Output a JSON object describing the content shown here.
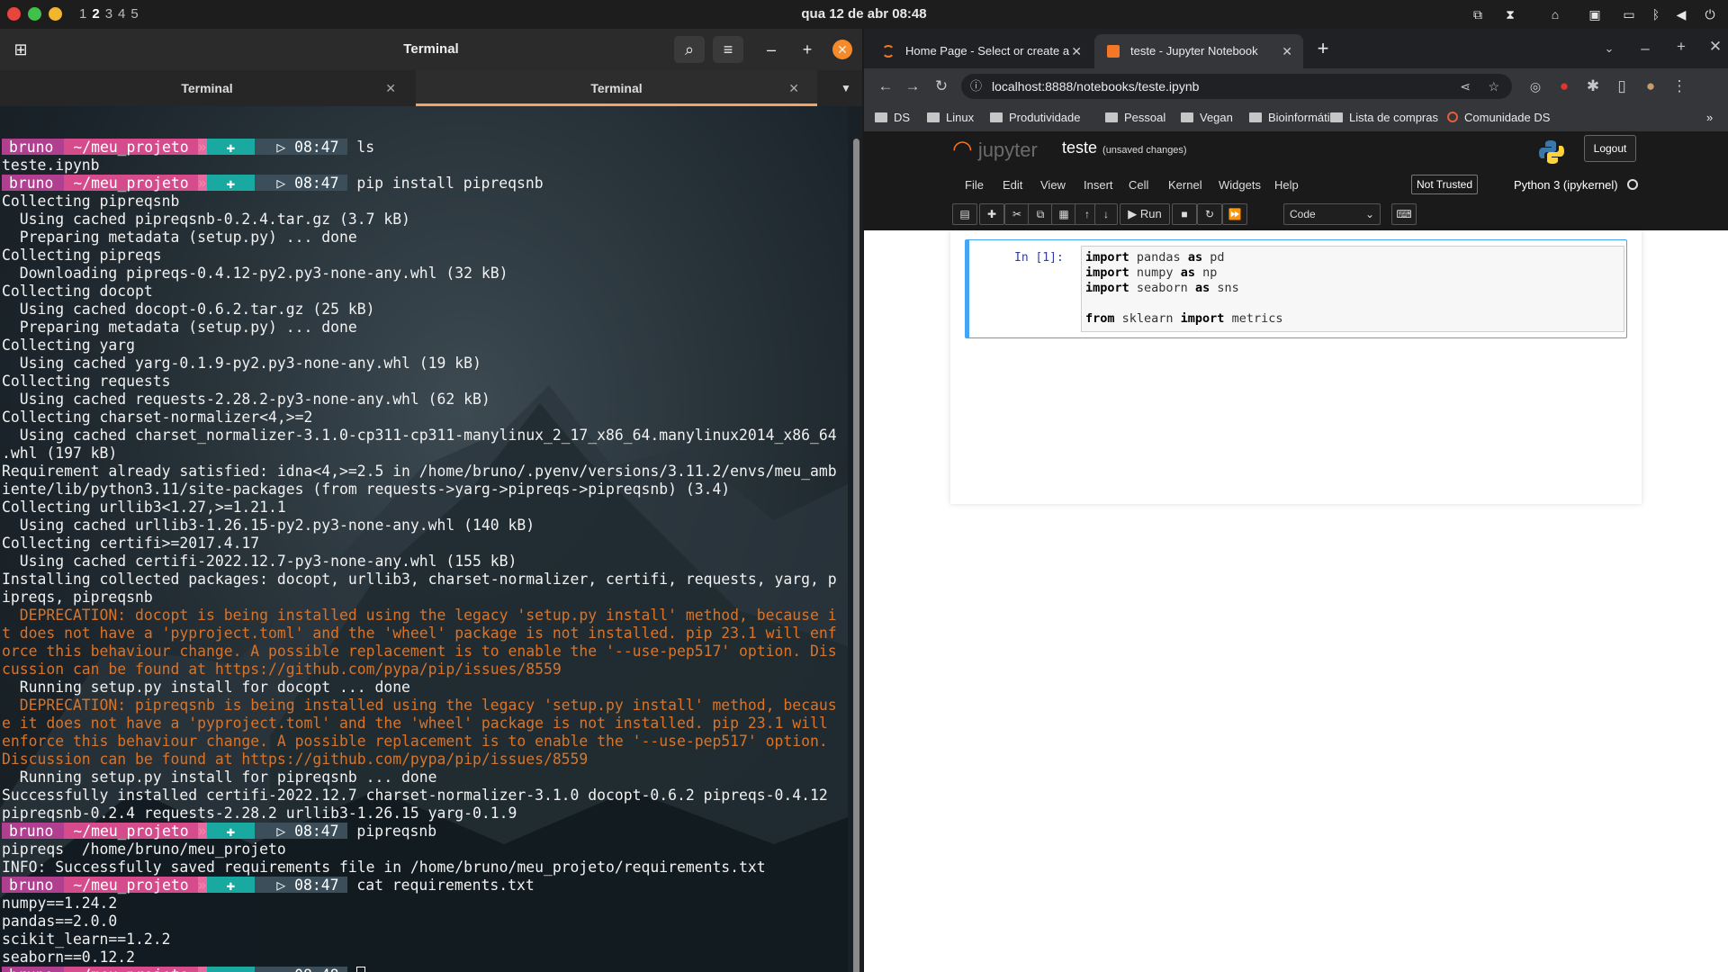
{
  "topbar": {
    "workspaces": [
      "1",
      "2",
      "3",
      "4",
      "5"
    ],
    "active_workspace": "2",
    "clock": "qua 12 de abr  08:48",
    "tray_icons": [
      "clipboard-icon",
      "hourglass-icon",
      "keyboard-icon",
      "display-icon",
      "screen-icon",
      "bluetooth-icon",
      "volume-icon",
      "power-icon"
    ]
  },
  "terminal": {
    "title": "Terminal",
    "tabs": [
      {
        "label": "Terminal"
      },
      {
        "label": "Terminal"
      }
    ],
    "prompt": {
      "user": "bruno",
      "dir": "~/meu_projeto",
      "git": "✚",
      "arrow": "▷"
    },
    "lines": [
      {
        "type": "prompt",
        "time": "08:47",
        "cmd": "ls"
      },
      {
        "type": "out",
        "text": "teste.ipynb"
      },
      {
        "type": "prompt",
        "time": "08:47",
        "cmd": "pip install pipreqsnb"
      },
      {
        "type": "out",
        "text": "Collecting pipreqsnb"
      },
      {
        "type": "out",
        "text": "  Using cached pipreqsnb-0.2.4.tar.gz (3.7 kB)"
      },
      {
        "type": "out",
        "text": "  Preparing metadata (setup.py) ... done"
      },
      {
        "type": "out",
        "text": "Collecting pipreqs"
      },
      {
        "type": "out",
        "text": "  Downloading pipreqs-0.4.12-py2.py3-none-any.whl (32 kB)"
      },
      {
        "type": "out",
        "text": "Collecting docopt"
      },
      {
        "type": "out",
        "text": "  Using cached docopt-0.6.2.tar.gz (25 kB)"
      },
      {
        "type": "out",
        "text": "  Preparing metadata (setup.py) ... done"
      },
      {
        "type": "out",
        "text": "Collecting yarg"
      },
      {
        "type": "out",
        "text": "  Using cached yarg-0.1.9-py2.py3-none-any.whl (19 kB)"
      },
      {
        "type": "out",
        "text": "Collecting requests"
      },
      {
        "type": "out",
        "text": "  Using cached requests-2.28.2-py3-none-any.whl (62 kB)"
      },
      {
        "type": "out",
        "text": "Collecting charset-normalizer<4,>=2"
      },
      {
        "type": "out",
        "text": "  Using cached charset_normalizer-3.1.0-cp311-cp311-manylinux_2_17_x86_64.manylinux2014_x86_64"
      },
      {
        "type": "out",
        "text": ".whl (197 kB)"
      },
      {
        "type": "out",
        "text": "Requirement already satisfied: idna<4,>=2.5 in /home/bruno/.pyenv/versions/3.11.2/envs/meu_amb"
      },
      {
        "type": "out",
        "text": "iente/lib/python3.11/site-packages (from requests->yarg->pipreqs->pipreqsnb) (3.4)"
      },
      {
        "type": "out",
        "text": "Collecting urllib3<1.27,>=1.21.1"
      },
      {
        "type": "out",
        "text": "  Using cached urllib3-1.26.15-py2.py3-none-any.whl (140 kB)"
      },
      {
        "type": "out",
        "text": "Collecting certifi>=2017.4.17"
      },
      {
        "type": "out",
        "text": "  Using cached certifi-2022.12.7-py3-none-any.whl (155 kB)"
      },
      {
        "type": "out",
        "text": "Installing collected packages: docopt, urllib3, charset-normalizer, certifi, requests, yarg, p"
      },
      {
        "type": "out",
        "text": "ipreqs, pipreqsnb"
      },
      {
        "type": "warn",
        "text": "  DEPRECATION: docopt is being installed using the legacy 'setup.py install' method, because i"
      },
      {
        "type": "warn",
        "text": "t does not have a 'pyproject.toml' and the 'wheel' package is not installed. pip 23.1 will enf"
      },
      {
        "type": "warn",
        "text": "orce this behaviour change. A possible replacement is to enable the '--use-pep517' option. Dis"
      },
      {
        "type": "warn",
        "text": "cussion can be found at https://github.com/pypa/pip/issues/8559"
      },
      {
        "type": "out",
        "text": "  Running setup.py install for docopt ... done"
      },
      {
        "type": "warn",
        "text": "  DEPRECATION: pipreqsnb is being installed using the legacy 'setup.py install' method, becaus"
      },
      {
        "type": "warn",
        "text": "e it does not have a 'pyproject.toml' and the 'wheel' package is not installed. pip 23.1 will"
      },
      {
        "type": "warn",
        "text": "enforce this behaviour change. A possible replacement is to enable the '--use-pep517' option."
      },
      {
        "type": "warn",
        "text": "Discussion can be found at https://github.com/pypa/pip/issues/8559"
      },
      {
        "type": "out",
        "text": "  Running setup.py install for pipreqsnb ... done"
      },
      {
        "type": "out",
        "text": "Successfully installed certifi-2022.12.7 charset-normalizer-3.1.0 docopt-0.6.2 pipreqs-0.4.12"
      },
      {
        "type": "out",
        "text": "pipreqsnb-0.2.4 requests-2.28.2 urllib3-1.26.15 yarg-0.1.9"
      },
      {
        "type": "prompt",
        "time": "08:47",
        "cmd": "pipreqsnb"
      },
      {
        "type": "out",
        "text": "pipreqs  /home/bruno/meu_projeto"
      },
      {
        "type": "out",
        "text": "INFO: Successfully saved requirements file in /home/bruno/meu_projeto/requirements.txt"
      },
      {
        "type": "prompt",
        "time": "08:47",
        "cmd": "cat requirements.txt"
      },
      {
        "type": "out",
        "text": "numpy==1.24.2"
      },
      {
        "type": "out",
        "text": "pandas==2.0.0"
      },
      {
        "type": "out",
        "text": "scikit_learn==1.2.2"
      },
      {
        "type": "out",
        "text": "seaborn==0.12.2"
      },
      {
        "type": "prompt",
        "time": "08:48",
        "cmd": "",
        "cursor": true
      }
    ]
  },
  "browser": {
    "tabs": [
      {
        "label": "Home Page - Select or create a"
      },
      {
        "label": "teste - Jupyter Notebook"
      }
    ],
    "url": "localhost:8888/notebooks/teste.ipynb",
    "bookmarks": [
      "DS",
      "Linux",
      "Produtividade",
      "Pessoal",
      "Vegan",
      "Bioinformática",
      "Lista de compras",
      "Comunidade DS"
    ]
  },
  "jupyter": {
    "logo_text": "jupyter",
    "notebook_name": "teste",
    "save_status": "(unsaved changes)",
    "logout": "Logout",
    "menu": [
      "File",
      "Edit",
      "View",
      "Insert",
      "Cell",
      "Kernel",
      "Widgets",
      "Help"
    ],
    "trusted": "Not Trusted",
    "kernel": "Python 3 (ipykernel)",
    "run": "Run",
    "cell_type": "Code",
    "cell_prompt": "In [1]:",
    "code": [
      [
        {
          "k": "import"
        },
        {
          "t": " pandas "
        },
        {
          "k": "as"
        },
        {
          "t": " pd"
        }
      ],
      [
        {
          "k": "import"
        },
        {
          "t": " numpy "
        },
        {
          "k": "as"
        },
        {
          "t": " np"
        }
      ],
      [
        {
          "k": "import"
        },
        {
          "t": " seaborn "
        },
        {
          "k": "as"
        },
        {
          "t": " sns"
        }
      ],
      [],
      [
        {
          "k": "from"
        },
        {
          "t": " sklearn "
        },
        {
          "k": "import"
        },
        {
          "t": " metrics"
        }
      ]
    ]
  }
}
